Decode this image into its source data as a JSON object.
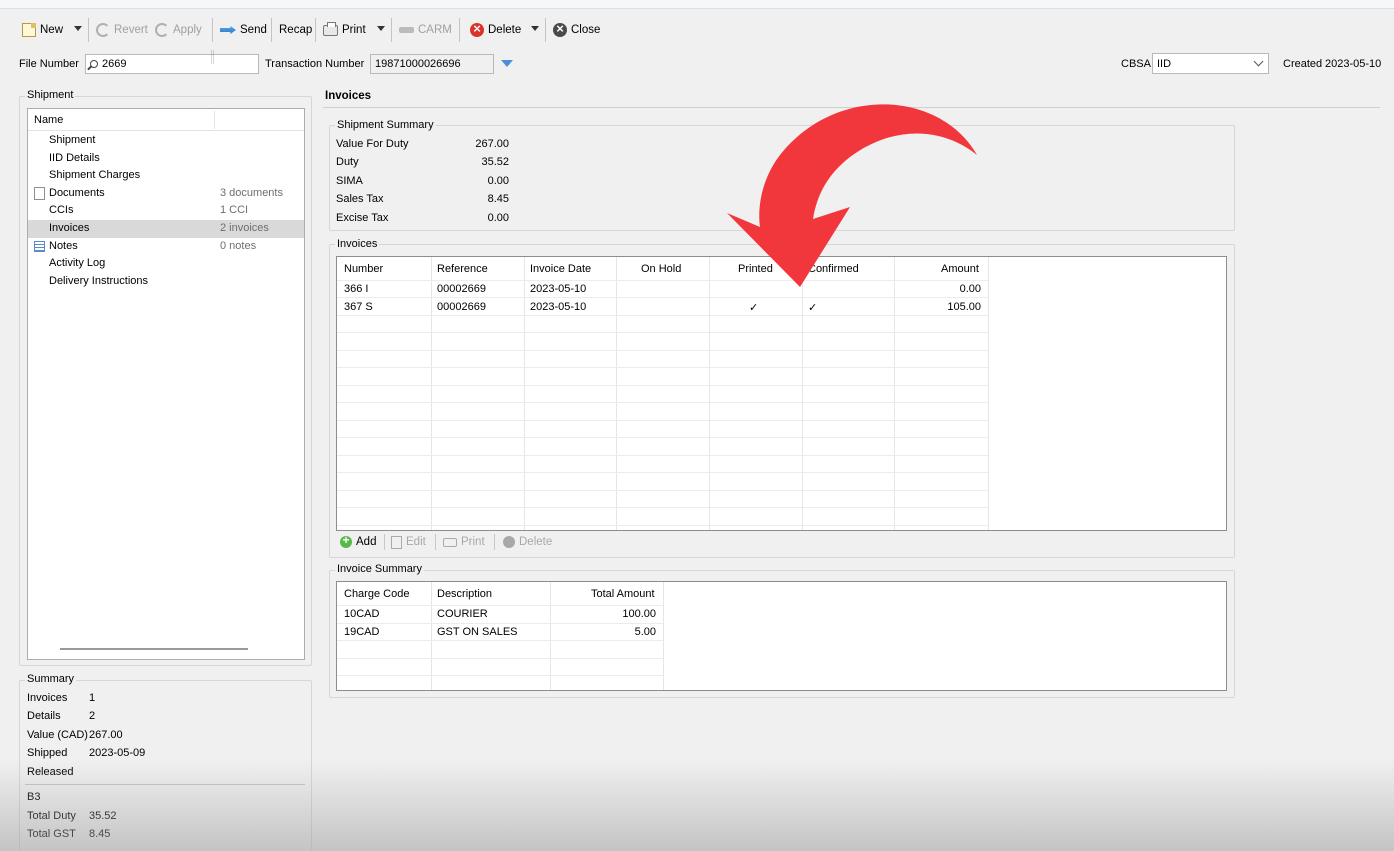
{
  "toolbar": {
    "new_label": "New",
    "revert_label": "Revert",
    "apply_label": "Apply",
    "send_label": "Send",
    "recap_label": "Recap",
    "print_label": "Print",
    "carm_label": "CARM",
    "delete_label": "Delete",
    "close_label": "Close"
  },
  "header": {
    "file_number_label": "File Number",
    "file_number_value": "2669",
    "transaction_number_label": "Transaction Number",
    "transaction_number_value": "19871000026696",
    "cbsa_label": "CBSA",
    "cbsa_value": "IID",
    "created_label": "Created",
    "created_value": "2023-05-10"
  },
  "sidebar": {
    "group_title": "Shipment",
    "column_name": "Name",
    "items": [
      {
        "label": "Shipment",
        "count": ""
      },
      {
        "label": "IID Details",
        "count": ""
      },
      {
        "label": "Shipment Charges",
        "count": ""
      },
      {
        "label": "Documents",
        "count": "3 documents",
        "icon": "document-icon"
      },
      {
        "label": "CCIs",
        "count": "1 CCI"
      },
      {
        "label": "Invoices",
        "count": "2 invoices",
        "selected": true
      },
      {
        "label": "Notes",
        "count": "0 notes",
        "icon": "notes-icon"
      },
      {
        "label": "Activity Log",
        "count": ""
      },
      {
        "label": "Delivery Instructions",
        "count": ""
      }
    ]
  },
  "summary": {
    "title": "Summary",
    "rows": [
      {
        "label": "Invoices",
        "value": "1"
      },
      {
        "label": "Details",
        "value": "2"
      },
      {
        "label": "Value (CAD)",
        "value": "267.00"
      },
      {
        "label": "Shipped",
        "value": "2023-05-09"
      },
      {
        "label": "Released",
        "value": ""
      }
    ],
    "rows2": [
      {
        "label": "B3",
        "value": ""
      },
      {
        "label": "Total Duty",
        "value": "35.52"
      },
      {
        "label": "Total GST",
        "value": "8.45"
      }
    ]
  },
  "main": {
    "section_title": "Invoices",
    "shipment_summary": {
      "title": "Shipment Summary",
      "rows": [
        {
          "label": "Value For Duty",
          "value": "267.00"
        },
        {
          "label": "Duty",
          "value": "35.52"
        },
        {
          "label": "SIMA",
          "value": "0.00"
        },
        {
          "label": "Sales Tax",
          "value": "8.45"
        },
        {
          "label": "Excise Tax",
          "value": "0.00"
        }
      ]
    },
    "invoices": {
      "title": "Invoices",
      "columns": [
        "Number",
        "Reference",
        "Invoice Date",
        "On Hold",
        "Printed",
        "Confirmed",
        "Amount"
      ],
      "rows": [
        {
          "number": "366 I",
          "reference": "00002669",
          "date": "2023-05-10",
          "on_hold": "",
          "printed": "",
          "confirmed": "",
          "amount": "0.00"
        },
        {
          "number": "367 S",
          "reference": "00002669",
          "date": "2023-05-10",
          "on_hold": "",
          "printed": "✓",
          "confirmed": "✓",
          "amount": "105.00"
        }
      ],
      "actions": {
        "add": "Add",
        "edit": "Edit",
        "print": "Print",
        "delete": "Delete"
      }
    },
    "invoice_summary": {
      "title": "Invoice Summary",
      "columns": [
        "Charge Code",
        "Description",
        "Total Amount"
      ],
      "rows": [
        {
          "code": "10CAD",
          "description": "COURIER",
          "total": "100.00"
        },
        {
          "code": "19CAD",
          "description": "GST ON SALES",
          "total": "5.00"
        }
      ]
    }
  },
  "colors": {
    "annotation_arrow": "#f2373c",
    "selected_row": "#d9d9d9"
  }
}
